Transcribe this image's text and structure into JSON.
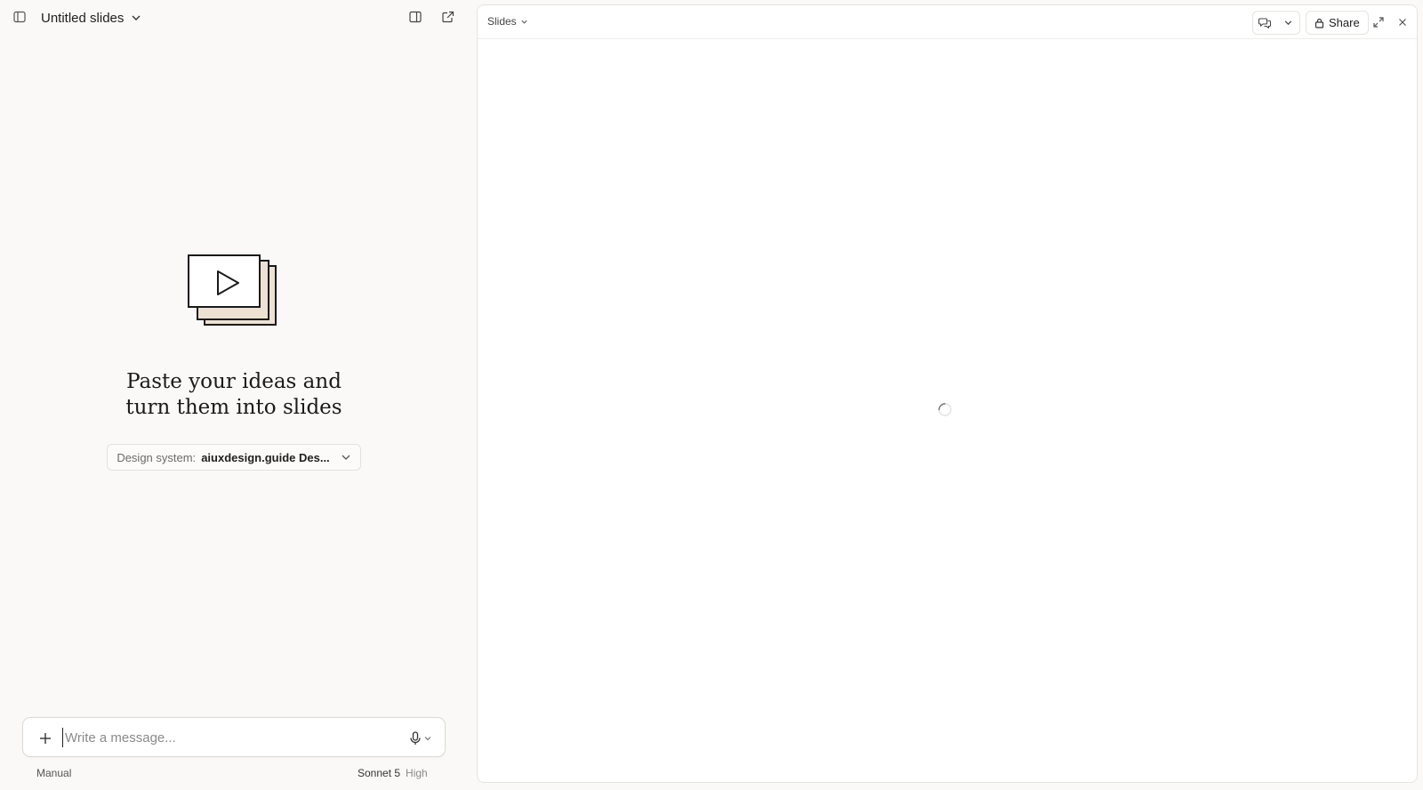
{
  "topbar": {
    "title": "Untitled slides",
    "sidebar_icon": "sidebar-icon",
    "panel_icon": "split-panel-icon",
    "open_icon": "open-external-icon"
  },
  "empty_state": {
    "headline_line1": "Paste your ideas and",
    "headline_line2": "turn them into slides",
    "design_system_label": "Design system:",
    "design_system_value": "aiuxdesign.guide Des..."
  },
  "composer": {
    "placeholder": "Write a message...",
    "value": ""
  },
  "footer": {
    "mode": "Manual",
    "model": "Sonnet 5",
    "effort": "High"
  },
  "preview": {
    "view_label": "Slides",
    "share_label": "Share"
  },
  "colors": {
    "background": "#faf9f7",
    "panel": "#ffffff",
    "border": "#e6e4df",
    "illustration_fill": "#ece1d3"
  }
}
